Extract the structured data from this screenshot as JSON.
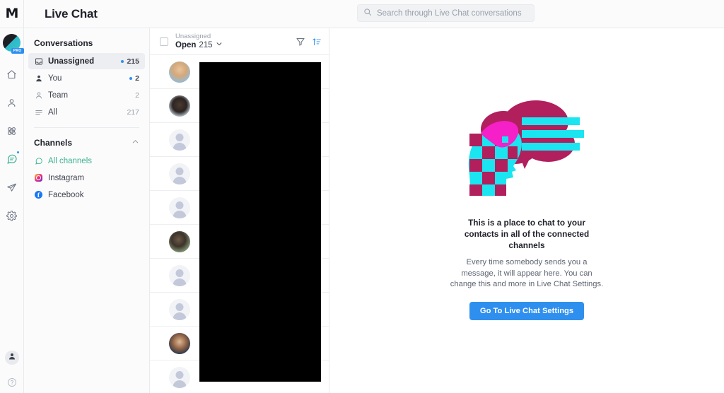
{
  "header": {
    "logo": "M",
    "title": "Live Chat",
    "search": {
      "placeholder": "Search through Live Chat conversations",
      "value": "",
      "icon": "search-icon"
    }
  },
  "rail": {
    "avatar": {
      "badge": "PRO"
    },
    "items": [
      {
        "icon": "home-icon",
        "name": "home",
        "active": false,
        "dot": false
      },
      {
        "icon": "contacts-icon",
        "name": "contacts",
        "active": false,
        "dot": false
      },
      {
        "icon": "automation-icon",
        "name": "automation",
        "active": false,
        "dot": false
      },
      {
        "icon": "live-chat-icon",
        "name": "live-chat",
        "active": true,
        "dot": true
      },
      {
        "icon": "send-icon",
        "name": "campaigns",
        "active": false,
        "dot": false
      },
      {
        "icon": "settings-gear-icon",
        "name": "settings",
        "active": false,
        "dot": false
      }
    ],
    "bottom": [
      {
        "icon": "user-avatar-icon",
        "name": "account"
      },
      {
        "icon": "help-circle-icon",
        "name": "help"
      }
    ]
  },
  "sidebar": {
    "conversations_heading": "Conversations",
    "conversation_items": [
      {
        "label": "Unassigned",
        "count": "215",
        "dot": true,
        "active": true,
        "icon": "inbox-icon"
      },
      {
        "label": "You",
        "count": "2",
        "dot": true,
        "active": false,
        "icon": "user-filled-icon"
      },
      {
        "label": "Team",
        "count": "2",
        "dot": false,
        "active": false,
        "icon": "user-outline-icon"
      },
      {
        "label": "All",
        "count": "217",
        "dot": false,
        "active": false,
        "icon": "list-icon"
      }
    ],
    "channels_heading": "Channels",
    "channels_collapse_icon": "chevron-up-icon",
    "channel_items": [
      {
        "label": "All channels",
        "icon": "all-channels-icon",
        "highlight": true
      },
      {
        "label": "Instagram",
        "icon": "instagram-icon",
        "highlight": false
      },
      {
        "label": "Facebook",
        "icon": "facebook-icon",
        "highlight": false
      }
    ]
  },
  "conversation_list": {
    "select_all_checkbox": false,
    "filter_sub_label": "Unassigned",
    "filter_label": "Open",
    "filter_count": "215",
    "filter_chevron_icon": "chevron-down-icon",
    "filter_icon": "funnel-filter-icon",
    "sort_icon": "sort-ascending-icon",
    "rows": [
      {
        "avatar": "photo-1"
      },
      {
        "avatar": "photo-2"
      },
      {
        "avatar": "placeholder"
      },
      {
        "avatar": "placeholder"
      },
      {
        "avatar": "placeholder"
      },
      {
        "avatar": "photo-3"
      },
      {
        "avatar": "placeholder"
      },
      {
        "avatar": "placeholder"
      },
      {
        "avatar": "photo-4"
      },
      {
        "avatar": "placeholder"
      }
    ]
  },
  "main": {
    "illustration": "chat-head-speech-bubble-illustration",
    "empty_title": "This is a place to chat to your contacts in all of the connected channels",
    "empty_body": "Every time somebody sends you a message, it will appear here. You can change this and more in Live Chat Settings.",
    "cta_label": "Go To Live Chat Settings"
  },
  "colors": {
    "accent_blue": "#2f8fee",
    "illustration_crimson": "#b11f5c",
    "illustration_cyan": "#1ae5f0",
    "illustration_magenta": "#f520c8",
    "channel_green": "#3db38f",
    "redaction": "#000000"
  }
}
